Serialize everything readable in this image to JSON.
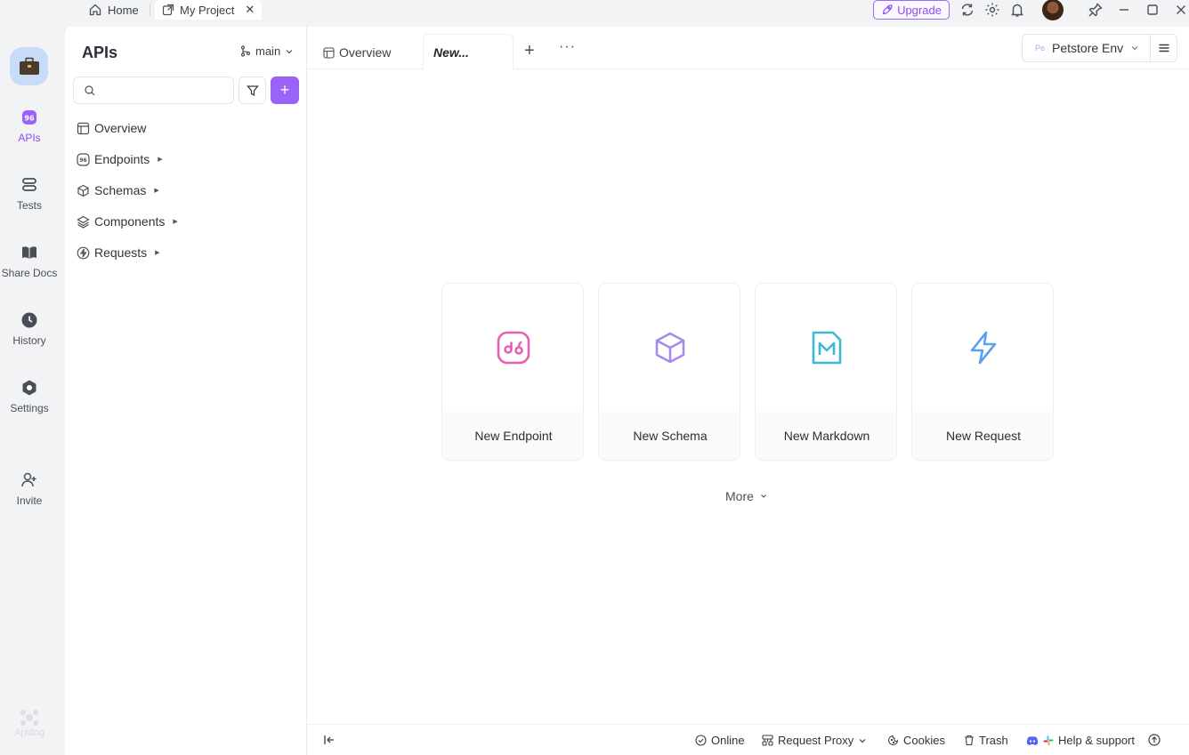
{
  "titlebar": {
    "home_label": "Home",
    "project_label": "My Project",
    "close_glyph": "✕",
    "upgrade_label": "Upgrade"
  },
  "rail": {
    "items": [
      {
        "label": "APIs",
        "icon": "api-icon",
        "active": true
      },
      {
        "label": "Tests",
        "icon": "tests-icon"
      },
      {
        "label": "Share Docs",
        "icon": "book-icon"
      },
      {
        "label": "History",
        "icon": "clock-icon"
      },
      {
        "label": "Settings",
        "icon": "gear-icon"
      },
      {
        "label": "Invite",
        "icon": "user-plus-icon"
      }
    ],
    "brand": "Apidog"
  },
  "sidebar": {
    "title": "APIs",
    "branch": "main",
    "search_placeholder": "",
    "add_glyph": "+",
    "tree": [
      {
        "label": "Overview",
        "icon": "overview-icon",
        "has_children": false
      },
      {
        "label": "Endpoints",
        "icon": "endpoint-icon",
        "has_children": true
      },
      {
        "label": "Schemas",
        "icon": "cube-icon",
        "has_children": true
      },
      {
        "label": "Components",
        "icon": "layers-icon",
        "has_children": true
      },
      {
        "label": "Requests",
        "icon": "bolt-icon",
        "has_children": true
      }
    ]
  },
  "main": {
    "tabs": [
      {
        "label": "Overview"
      },
      {
        "label": "New..."
      }
    ],
    "plus_glyph": "+",
    "more_glyph": "···",
    "env": {
      "badge": "Pe",
      "label": "Petstore Env"
    },
    "cards": [
      {
        "label": "New Endpoint",
        "icon": "endpoint-icon",
        "color": "#e95fb1"
      },
      {
        "label": "New Schema",
        "icon": "cube-icon",
        "color": "#a78bea"
      },
      {
        "label": "New Markdown",
        "icon": "markdown-icon",
        "color": "#3fb8d6"
      },
      {
        "label": "New Request",
        "icon": "bolt-icon",
        "color": "#5aa2ef"
      }
    ],
    "more_label": "More"
  },
  "statusbar": {
    "online": "Online",
    "proxy": "Request Proxy",
    "cookies": "Cookies",
    "trash": "Trash",
    "help": "Help & support"
  },
  "colors": {
    "accent": "#9b63f5",
    "upgrade_border": "#9a6bf3"
  }
}
